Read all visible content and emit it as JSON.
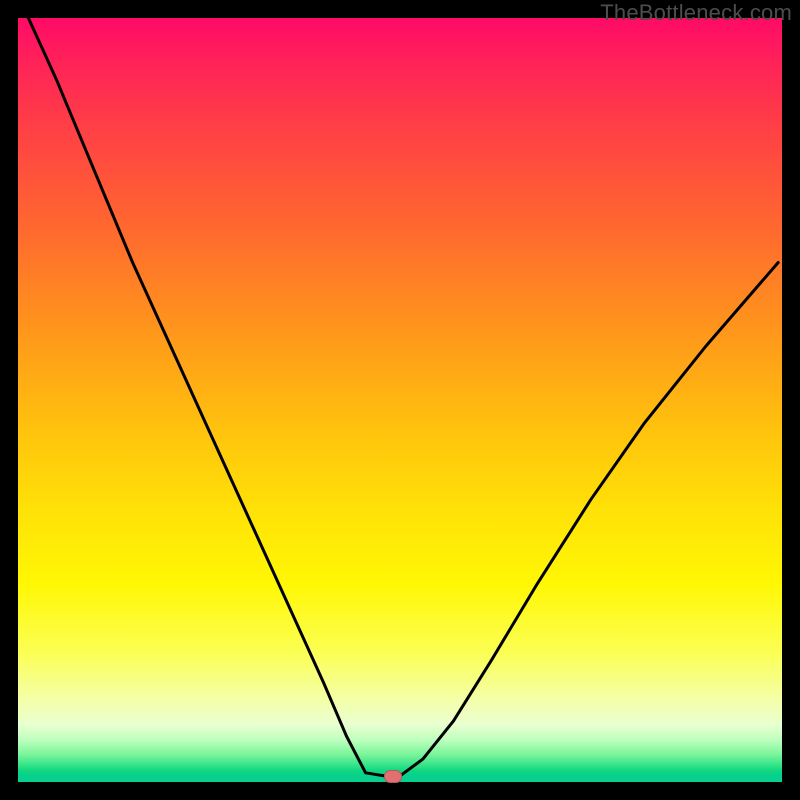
{
  "watermark": "TheBottleneck.com",
  "colors": {
    "frame": "#000000",
    "curve": "#000000",
    "marker_fill": "#e17070",
    "marker_stroke": "#b05a5a"
  },
  "chart_data": {
    "type": "line",
    "title": "",
    "xlabel": "",
    "ylabel": "",
    "xlim": [
      0,
      100
    ],
    "ylim": [
      0,
      100
    ],
    "grid": false,
    "series": [
      {
        "name": "left-branch",
        "x": [
          0,
          5,
          10,
          15,
          20,
          25,
          30,
          35,
          40,
          43,
          45.5,
          48
        ],
        "y": [
          103,
          92,
          80,
          68,
          57,
          46,
          35,
          24,
          13,
          6,
          1.2,
          0.8
        ]
      },
      {
        "name": "right-branch",
        "x": [
          50,
          53,
          57,
          62,
          68,
          75,
          82,
          90,
          99.5
        ],
        "y": [
          0.8,
          3,
          8,
          16,
          26,
          37,
          47,
          57,
          68
        ]
      }
    ],
    "annotations": [
      {
        "name": "minimum-marker",
        "x": 49,
        "y": 0.8
      }
    ],
    "background_gradient": {
      "direction": "top-to-bottom",
      "stops": [
        {
          "pos": 0.0,
          "color": "#ff0a67"
        },
        {
          "pos": 0.28,
          "color": "#ff6a2e"
        },
        {
          "pos": 0.55,
          "color": "#ffc60c"
        },
        {
          "pos": 0.74,
          "color": "#fff704"
        },
        {
          "pos": 0.9,
          "color": "#f4ffac"
        },
        {
          "pos": 0.97,
          "color": "#3de68c"
        },
        {
          "pos": 1.0,
          "color": "#07cf8e"
        }
      ]
    }
  }
}
